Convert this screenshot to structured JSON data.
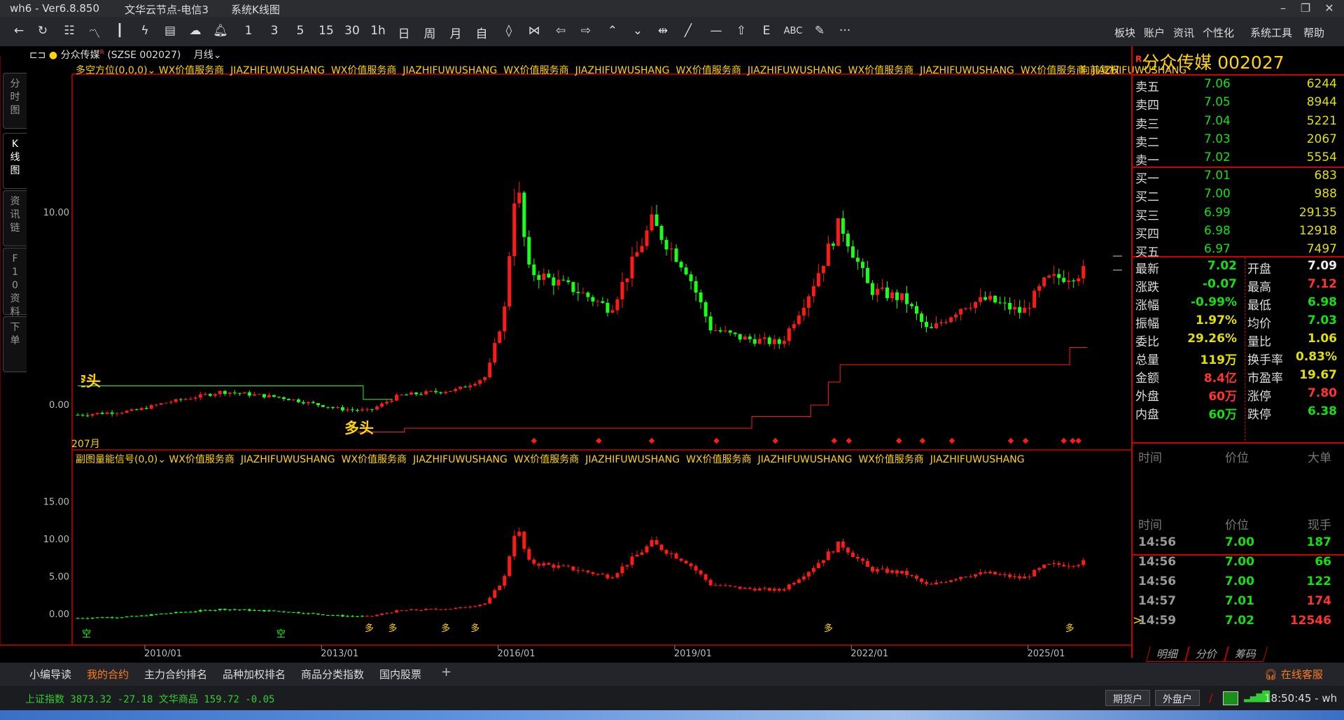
{
  "titlebar": {
    "app": "wh6  -  Ver6.8.850",
    "server": "文华云节点-电信3",
    "view": "系统K线图"
  },
  "toolbar": {
    "period_buttons": [
      "1",
      "3",
      "5",
      "15",
      "30",
      "1h",
      "日",
      "周",
      "月",
      "自"
    ],
    "menus": [
      "板块",
      "账户",
      "资讯",
      "个性化",
      "系统工具",
      "帮助"
    ]
  },
  "left_tabs": [
    "分时图",
    "K线图",
    "资讯链",
    "F10资料",
    "下单"
  ],
  "header": {
    "name": "分众传媒",
    "r_mark": "R",
    "code": "(SZSE 002027)",
    "period": "月线"
  },
  "main_indicator": {
    "name": "多空方位(0,0,0)",
    "items": [
      "WX价值服务商",
      "JIAZHIFUWUSHANG",
      "WX价值服务商",
      "JIAZHIFUWUSHANG",
      "WX价值服务商",
      "JIAZHIFUWUSHANG",
      "WX价值服务商",
      "JIAZHIFUWUSHANG",
      "WX价值服务商",
      "JIAZHIFUWUSHANG",
      "WX价值服务商",
      "JIAZHIFUWUSHANG"
    ],
    "adjust": "向前复权",
    "label_bear": "空头",
    "label_bull": "多头",
    "start_label": "207月"
  },
  "sub_indicator": {
    "name": "副图量能信号(0,0)",
    "items": [
      "WX价值服务商",
      "JIAZHIFUWUSHANG",
      "WX价值服务商",
      "JIAZHIFUWUSHANG",
      "WX价值服务商",
      "JIAZHIFUWUSHANG",
      "WX价值服务商",
      "JIAZHIFUWUSHANG",
      "WX价值服务商",
      "JIAZHIFUWUSHANG"
    ],
    "signal_bull": "多",
    "signal_bear": "空"
  },
  "chart_data": {
    "type": "candlestick",
    "period": "monthly",
    "start": 2008.55,
    "end": 2025.7,
    "price_ticks": [
      "10.00",
      "0.00"
    ],
    "sub_ticks": [
      "15.00",
      "10.00",
      "5.00",
      "0.00"
    ],
    "x_ticks": [
      "2010/01",
      "2013/01",
      "2016/01",
      "2019/01",
      "2022/01",
      "2025/01"
    ],
    "close_keypoints": [
      [
        2008.55,
        -0.5
      ],
      [
        2009.5,
        -0.3
      ],
      [
        2010.0,
        0.1
      ],
      [
        2011.0,
        0.7
      ],
      [
        2012.0,
        0.4
      ],
      [
        2013.0,
        -0.2
      ],
      [
        2013.5,
        -0.3
      ],
      [
        2014.0,
        0.5
      ],
      [
        2015.0,
        0.8
      ],
      [
        2015.5,
        1.5
      ],
      [
        2015.8,
        5
      ],
      [
        2016.0,
        12
      ],
      [
        2016.2,
        7
      ],
      [
        2017.0,
        6
      ],
      [
        2017.6,
        5
      ],
      [
        2018.3,
        9.5
      ],
      [
        2018.9,
        7
      ],
      [
        2019.3,
        4
      ],
      [
        2019.8,
        3.5
      ],
      [
        2020.5,
        3.2
      ],
      [
        2021.0,
        6
      ],
      [
        2021.5,
        9.5
      ],
      [
        2022.0,
        6
      ],
      [
        2022.6,
        5.5
      ],
      [
        2023.0,
        3.8
      ],
      [
        2023.6,
        5.2
      ],
      [
        2024.0,
        5.5
      ],
      [
        2024.6,
        4.8
      ],
      [
        2025.0,
        6.5
      ],
      [
        2025.5,
        6.8
      ],
      [
        2025.7,
        7.02
      ]
    ],
    "bear_line": [
      [
        2008.55,
        1.0
      ],
      [
        2013.3,
        1.0
      ],
      [
        2013.4,
        0.3
      ],
      [
        2013.9,
        0.3
      ]
    ],
    "bull_line": [
      [
        2013.3,
        -1.4
      ],
      [
        2014.0,
        -1.4
      ],
      [
        2014.1,
        -1.2
      ],
      [
        2019.0,
        -1.2
      ],
      [
        2020.0,
        -0.6
      ],
      [
        2021.0,
        0.0
      ],
      [
        2021.3,
        1.2
      ],
      [
        2021.5,
        2.1
      ],
      [
        2025.3,
        2.1
      ],
      [
        2025.4,
        3.0
      ],
      [
        2025.7,
        3.0
      ]
    ],
    "diamonds": [
      2016.3,
      2017.4,
      2018.3,
      2019.4,
      2020.4,
      2021.4,
      2021.65,
      2022.5,
      2022.9,
      2023.4,
      2024.4,
      2024.65,
      2025.3,
      2025.45,
      2025.55
    ],
    "sub_signals_bull": [
      2013.5,
      2013.9,
      2014.8,
      2015.3,
      2021.3,
      2025.4
    ],
    "sub_signals_bear": [
      2008.7,
      2012.0
    ]
  },
  "quote": {
    "r_mark": "R",
    "title": "分众传媒  002027",
    "asks": [
      {
        "label": "卖五",
        "price": "7.06",
        "vol": "6244"
      },
      {
        "label": "卖四",
        "price": "7.05",
        "vol": "8944"
      },
      {
        "label": "卖三",
        "price": "7.04",
        "vol": "5221"
      },
      {
        "label": "卖二",
        "price": "7.03",
        "vol": "2067"
      },
      {
        "label": "卖一",
        "price": "7.02",
        "vol": "5554"
      }
    ],
    "bids": [
      {
        "label": "买一",
        "price": "7.01",
        "vol": "683"
      },
      {
        "label": "买二",
        "price": "7.00",
        "vol": "988"
      },
      {
        "label": "买三",
        "price": "6.99",
        "vol": "29135"
      },
      {
        "label": "买四",
        "price": "6.98",
        "vol": "12918"
      },
      {
        "label": "买五",
        "price": "6.97",
        "vol": "7497"
      }
    ],
    "stats": [
      {
        "l1": "最新",
        "v1": "7.02",
        "c1": "g",
        "l2": "开盘",
        "v2": "7.09",
        "c2": "w"
      },
      {
        "l1": "涨跌",
        "v1": "-0.07",
        "c1": "g",
        "l2": "最高",
        "v2": "7.12",
        "c2": "r"
      },
      {
        "l1": "涨幅",
        "v1": "-0.99%",
        "c1": "g",
        "l2": "最低",
        "v2": "6.98",
        "c2": "g"
      },
      {
        "l1": "振幅",
        "v1": "1.97%",
        "c1": "y",
        "l2": "均价",
        "v2": "7.03",
        "c2": "g"
      },
      {
        "l1": "委比",
        "v1": "29.26%",
        "c1": "y",
        "l2": "量比",
        "v2": "1.06",
        "c2": "y"
      },
      {
        "l1": "总量",
        "v1": "119万",
        "c1": "y",
        "l2": "换手率",
        "v2": "0.83%",
        "c2": "y"
      },
      {
        "l1": "金额",
        "v1": "8.4亿",
        "c1": "r",
        "l2": "市盈率",
        "v2": "19.67",
        "c2": "y"
      },
      {
        "l1": "外盘",
        "v1": "60万",
        "c1": "r",
        "l2": "涨停",
        "v2": "7.80",
        "c2": "r"
      },
      {
        "l1": "内盘",
        "v1": "60万",
        "c1": "g",
        "l2": "跌停",
        "v2": "6.38",
        "c2": "g"
      }
    ],
    "bigorder_headers": [
      "时间",
      "价位",
      "大单"
    ],
    "trade_headers": [
      "时间",
      "价位",
      "现手"
    ],
    "trades": [
      {
        "t": "14:56",
        "p": "7.00",
        "v": "187",
        "c": "g"
      },
      {
        "t": "14:56",
        "p": "7.00",
        "v": "66",
        "c": "g"
      },
      {
        "t": "14:56",
        "p": "7.00",
        "v": "122",
        "c": "g"
      },
      {
        "t": "14:57",
        "p": "7.01",
        "v": "174",
        "c": "r"
      },
      {
        "t": "14:59",
        "p": "7.02",
        "v": "12546",
        "c": "r"
      }
    ],
    "tabs": [
      "明细",
      "分价",
      "筹码"
    ]
  },
  "bottom_tabs": [
    "小编导读",
    "我的合约",
    "主力合约排名",
    "品种加权排名",
    "商品分类指数",
    "国内股票"
  ],
  "add_tab": "+",
  "ticker": "上证指数  3873.32  -27.18   文华商品  159.72  -0.05",
  "status": {
    "btn1": "期货户",
    "btn2": "外盘户",
    "time": "18:50:45 - wh",
    "service": "在线客服"
  }
}
